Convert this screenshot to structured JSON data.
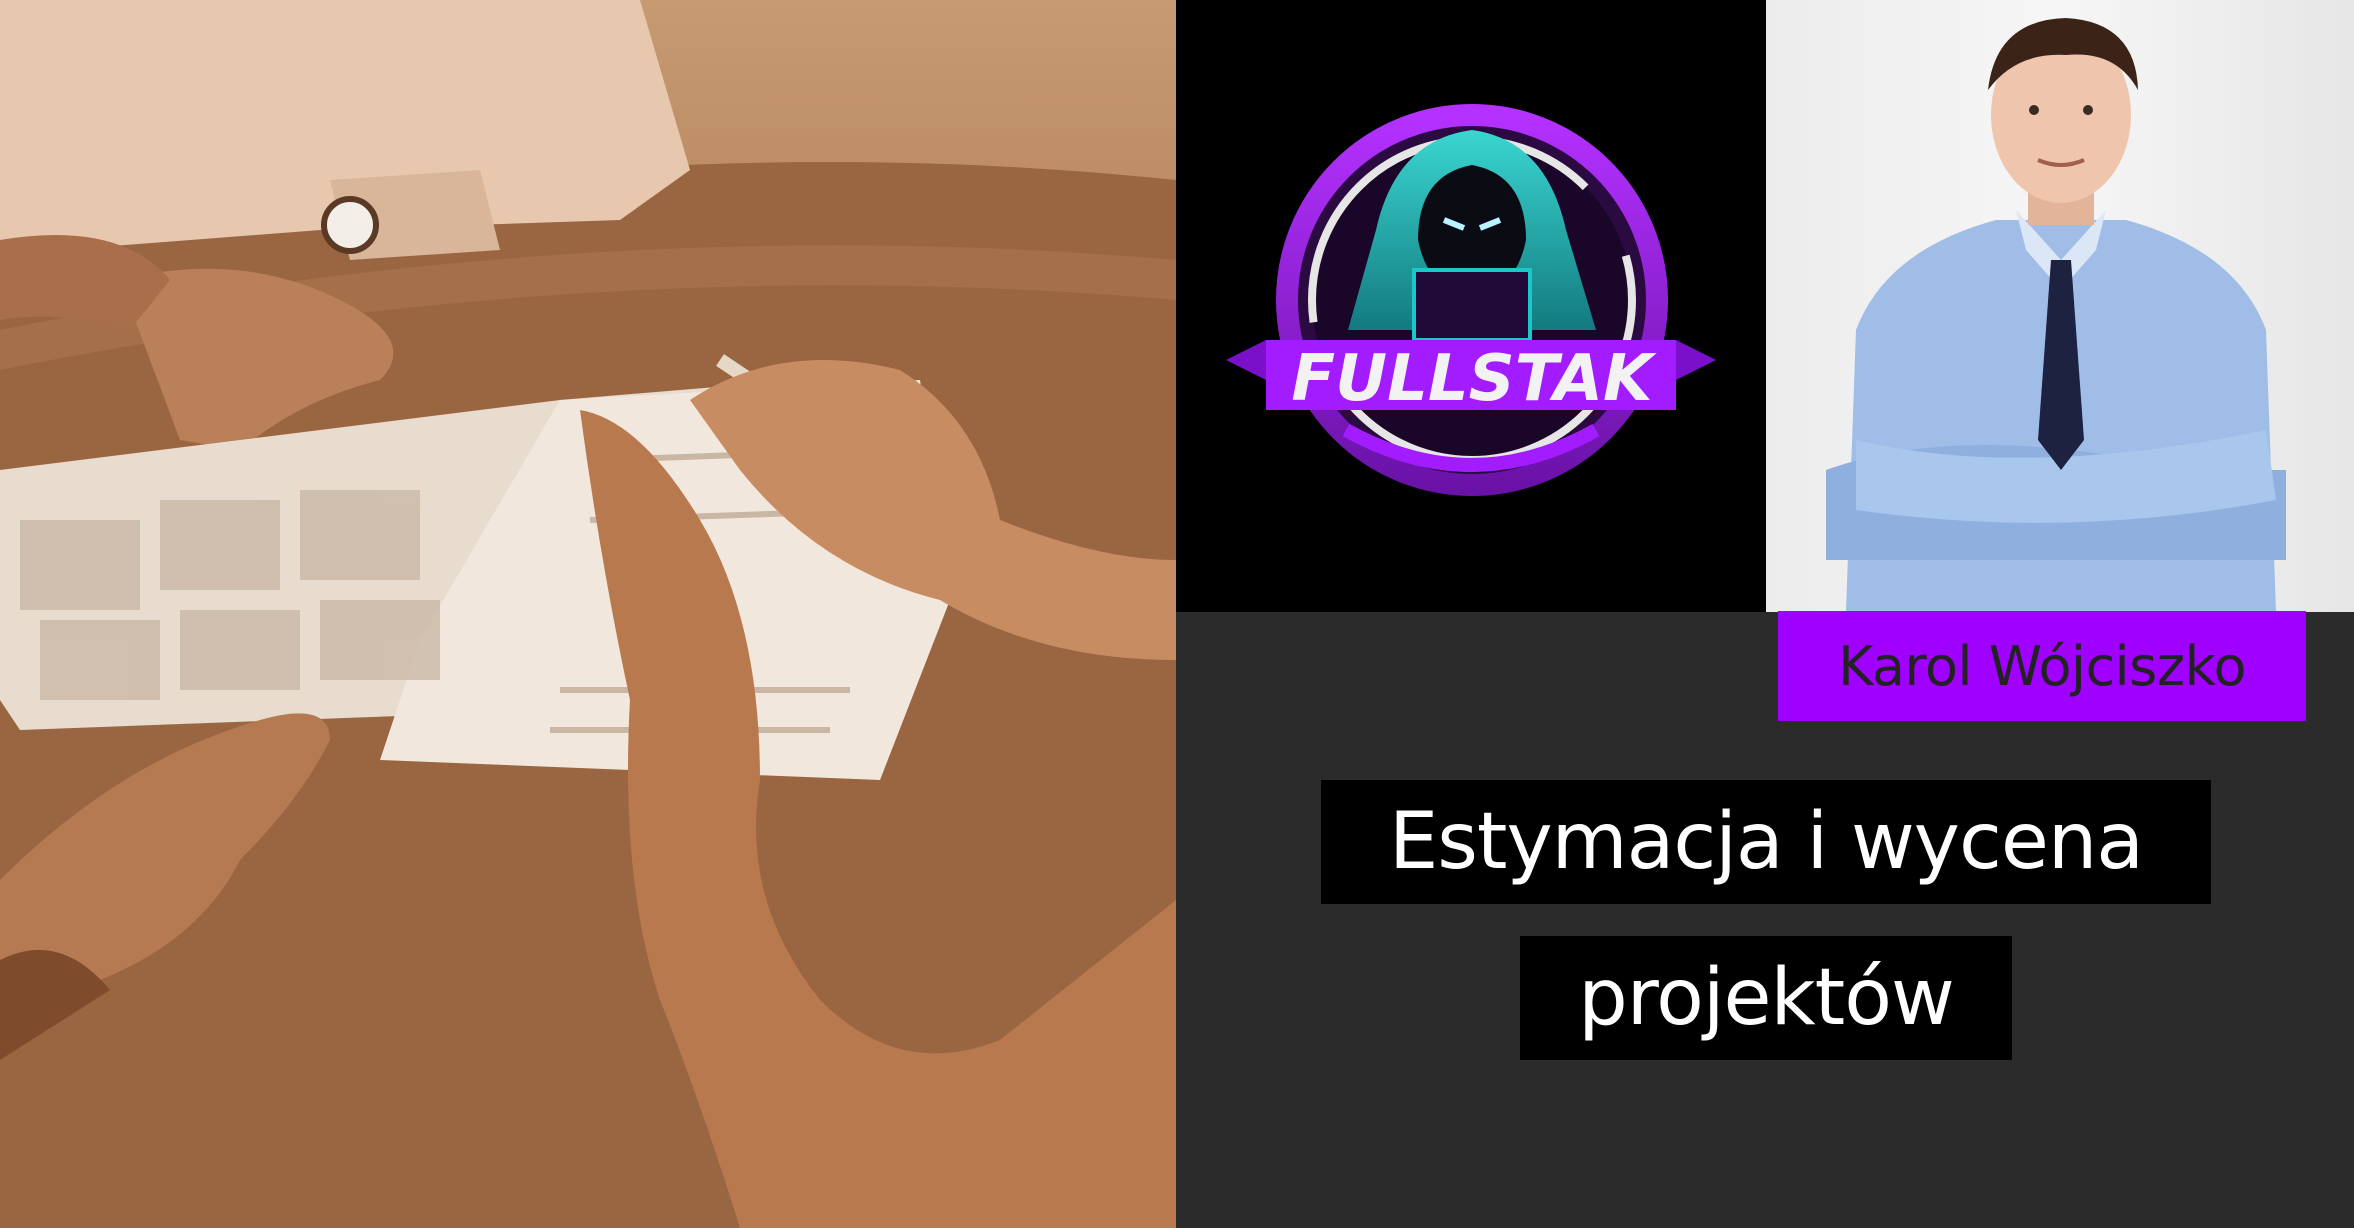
{
  "logo": {
    "text": "FULLSTAK"
  },
  "speaker": {
    "name": "Karol Wójciszko"
  },
  "title": {
    "line1": "Estymacja i wycena",
    "line2": "projektów"
  }
}
